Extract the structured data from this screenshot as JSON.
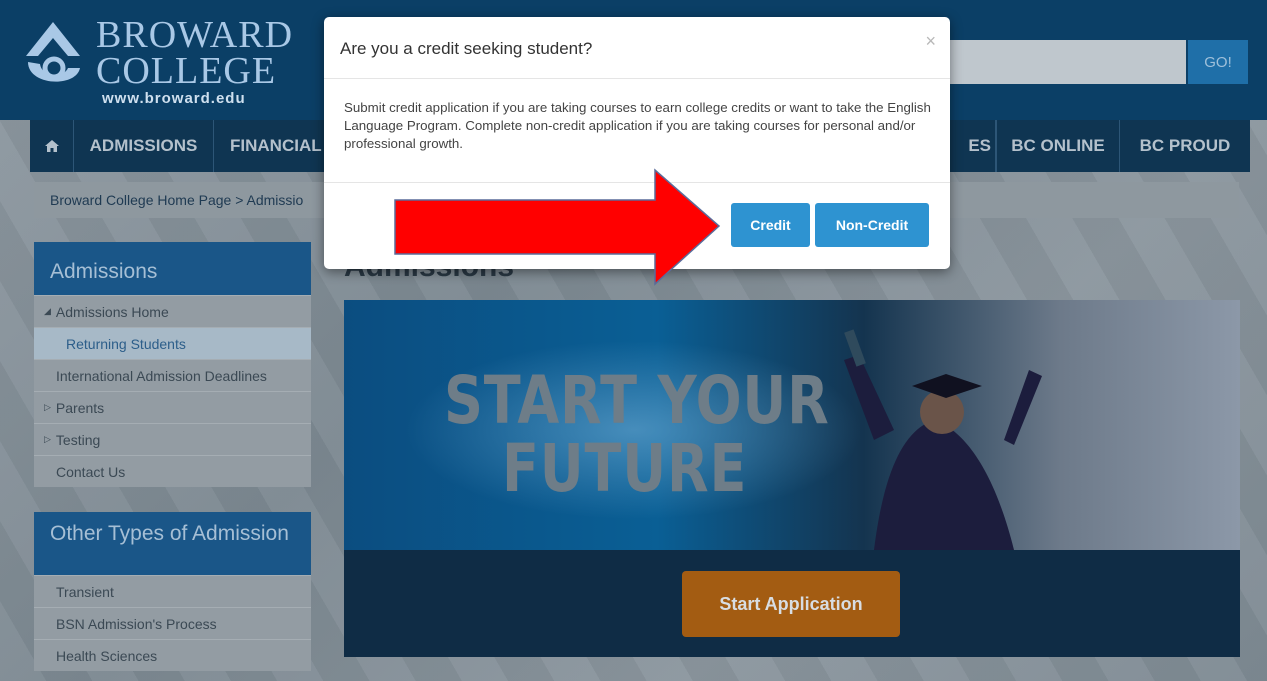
{
  "header": {
    "logo_line1": "BROWARD",
    "logo_line2": "COLLEGE",
    "logo_url": "www.broward.edu",
    "search_placeholder": "",
    "go_label": "GO!"
  },
  "nav": {
    "home_icon": "home-icon",
    "items": [
      "ADMISSIONS",
      "FINANCIAL",
      "ES",
      "BC ONLINE",
      "BC PROUD"
    ]
  },
  "breadcrumb": "Broward College Home Page > Admissio",
  "sidebar": {
    "admissions": {
      "title": "Admissions",
      "items": [
        {
          "label": "Admissions Home",
          "marker": "◢"
        },
        {
          "label": "Returning Students"
        },
        {
          "label": "International Admission Deadlines"
        },
        {
          "label": "Parents",
          "marker": "▷"
        },
        {
          "label": "Testing",
          "marker": "▷"
        },
        {
          "label": "Contact Us"
        }
      ]
    },
    "other": {
      "title": "Other Types of Admission",
      "items": [
        "Transient",
        "BSN Admission's Process",
        "Health Sciences"
      ]
    }
  },
  "main": {
    "heading": "Admissions",
    "hero_line1": "START YOUR",
    "hero_line2": "FUTURE",
    "start_button": "Start Application"
  },
  "modal": {
    "title": "Are you a credit seeking student?",
    "close": "×",
    "body": "Submit credit application if you are taking courses to earn college credits or want to take the English Language Program. Complete non-credit application if you are taking courses for personal and/or professional growth.",
    "credit_button": "Credit",
    "noncredit_button": "Non-Credit"
  },
  "colors": {
    "nav_bg": "#0f3552",
    "modal_button": "#2e93d1",
    "start_button": "#a35c12",
    "arrow": "#ff0000"
  }
}
